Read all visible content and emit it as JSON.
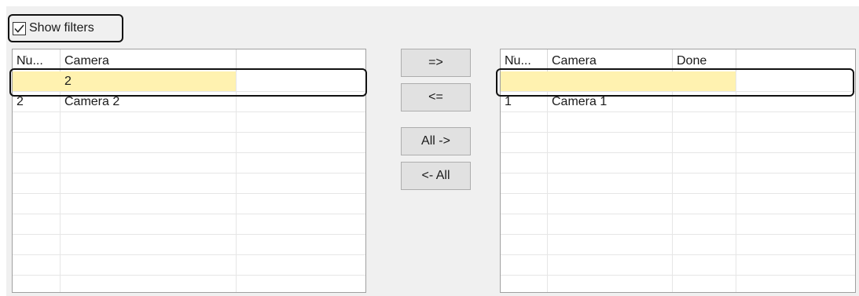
{
  "show_filters": {
    "label": "Show filters",
    "checked": true
  },
  "left_grid": {
    "columns": [
      "Nu...",
      "Camera"
    ],
    "filter_row": {
      "num": "",
      "camera": "2"
    },
    "rows": [
      {
        "num": "2",
        "camera": "Camera 2"
      }
    ]
  },
  "right_grid": {
    "columns": [
      "Nu...",
      "Camera",
      "Done"
    ],
    "filter_row": {
      "num": "",
      "camera": "",
      "done": ""
    },
    "rows": [
      {
        "num": "1",
        "camera": "Camera 1",
        "done": ""
      }
    ]
  },
  "buttons": {
    "add": "=>",
    "remove": "<=",
    "add_all": "All ->",
    "remove_all": "<- All"
  },
  "colors": {
    "filter_highlight": "#fff2b0",
    "highlight_border": "#111111"
  }
}
